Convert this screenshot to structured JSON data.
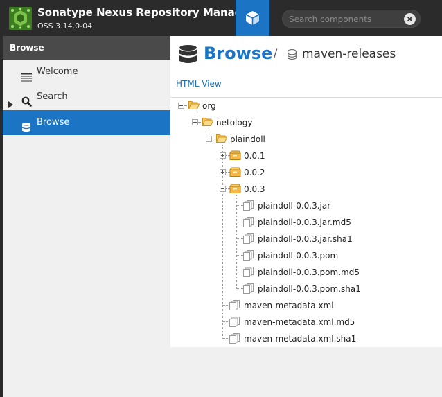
{
  "header": {
    "app_title": "Sonatype Nexus Repository Manager",
    "app_version": "OSS 3.14.0-04",
    "search_placeholder": "Search components",
    "accent_color": "#1b74c4",
    "logo_icon": "nexus-logo-icon",
    "browse_icon": "cube-icon",
    "clear_icon": "clear-search-icon"
  },
  "sidebar": {
    "heading": "Browse",
    "items": [
      {
        "label": "Welcome",
        "icon": "list-lines-icon"
      },
      {
        "label": "Search",
        "icon": "search-icon",
        "expandable": true
      },
      {
        "label": "Browse",
        "icon": "database-icon",
        "active": true
      }
    ]
  },
  "main": {
    "title": "Browse",
    "separator": "/",
    "repository": "maven-releases",
    "html_view_label": "HTML View"
  },
  "tree": {
    "org": "org",
    "netology": "netology",
    "plaindoll": "plaindoll",
    "versions": [
      "0.0.1",
      "0.0.2",
      "0.0.3"
    ],
    "v3_files": [
      "plaindoll-0.0.3.jar",
      "plaindoll-0.0.3.jar.md5",
      "plaindoll-0.0.3.jar.sha1",
      "plaindoll-0.0.3.pom",
      "plaindoll-0.0.3.pom.md5",
      "plaindoll-0.0.3.pom.sha1"
    ],
    "metadata_files": [
      "maven-metadata.xml",
      "maven-metadata.xml.md5",
      "maven-metadata.xml.sha1"
    ]
  }
}
